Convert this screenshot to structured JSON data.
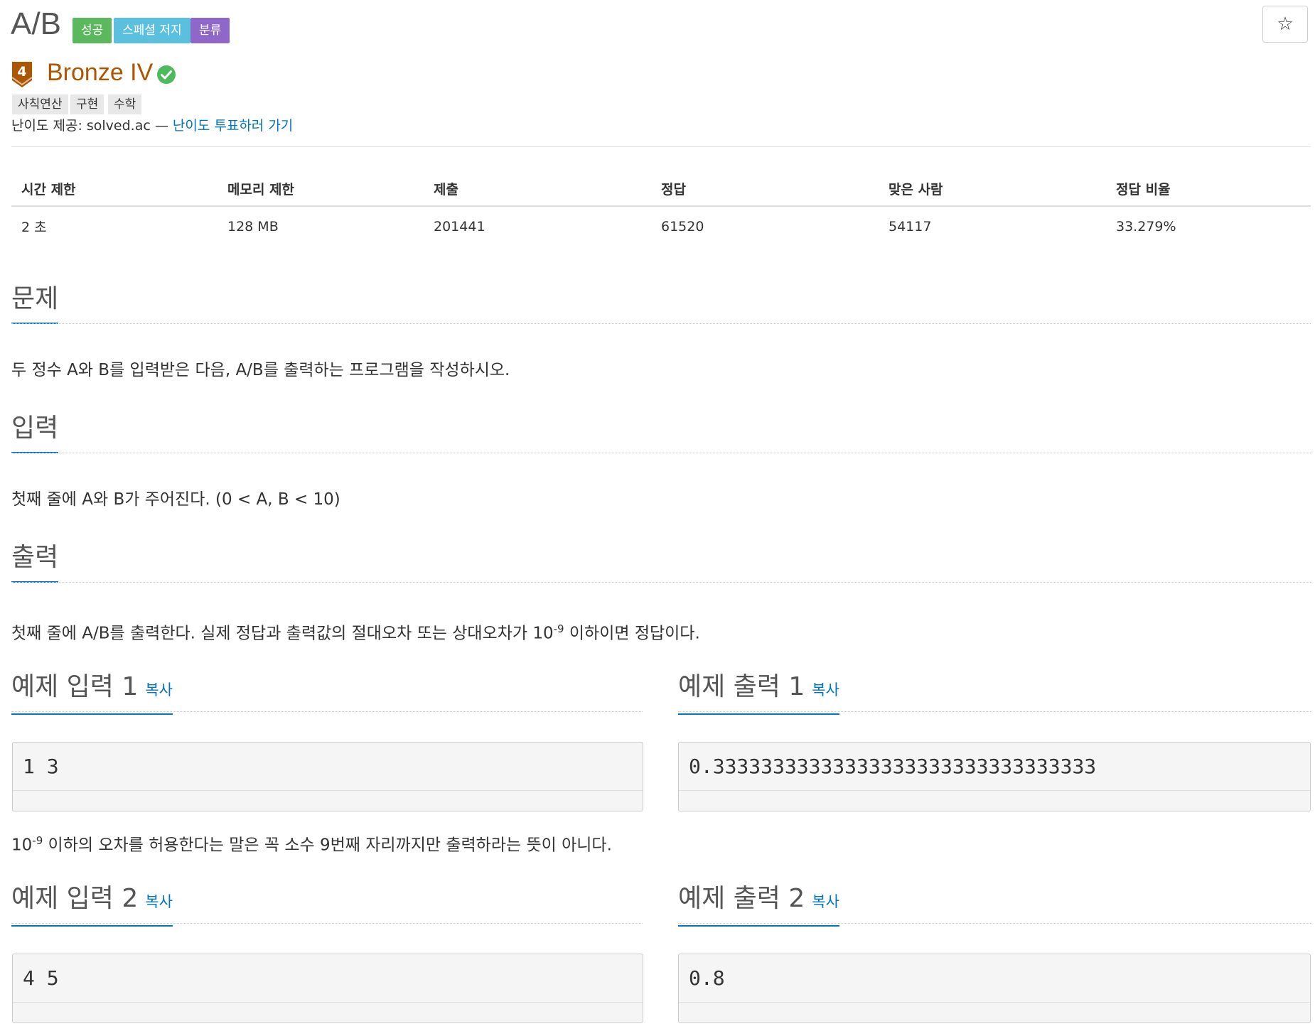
{
  "problem": {
    "title": "A/B",
    "labels": {
      "success": "성공",
      "special": "스페셜 저지",
      "classify": "분류"
    },
    "star": "☆"
  },
  "tier": {
    "number": "4",
    "name": "Bronze IV"
  },
  "tags": [
    "사칙연산",
    "구현",
    "수학"
  ],
  "credit": {
    "prefix": "난이도 제공: solved.ac — ",
    "link": "난이도 투표하러 가기"
  },
  "info": {
    "headers": [
      "시간 제한",
      "메모리 제한",
      "제출",
      "정답",
      "맞은 사람",
      "정답 비율"
    ],
    "values": [
      "2 초",
      "128 MB",
      "201441",
      "61520",
      "54117",
      "33.279%"
    ]
  },
  "description": {
    "title": "문제",
    "text": "두 정수 A와 B를 입력받은 다음, A/B를 출력하는 프로그램을 작성하시오."
  },
  "input": {
    "title": "입력",
    "text": "첫째 줄에 A와 B가 주어진다. (0 < A, B < 10)"
  },
  "output": {
    "title": "출력",
    "text_before": "첫째 줄에 A/B를 출력한다. 실제 정답과 출력값의 절대오차 또는 상대오차가 10",
    "exponent": "-9",
    "text_after": " 이하이면 정답이다."
  },
  "samples": [
    {
      "input_title": "예제 입력 1",
      "output_title": "예제 출력 1",
      "copy": "복사",
      "input": "1 3",
      "output": "0.33333333333333333333333333333333"
    },
    {
      "input_title": "예제 입력 2",
      "output_title": "예제 출력 2",
      "copy": "복사",
      "input": "4 5",
      "output": "0.8"
    }
  ],
  "hint": {
    "base": "10",
    "exponent": "-9",
    "text": " 이하의 오차를 허용한다는 말은 꼭 소수 9번째 자리까지만 출력하라는 뜻이 아니다."
  }
}
